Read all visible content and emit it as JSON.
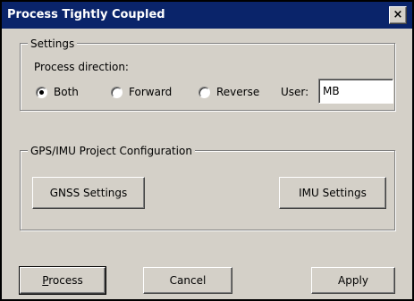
{
  "window": {
    "title": "Process Tightly Coupled",
    "close_label": "×"
  },
  "settings": {
    "legend": "Settings",
    "process_direction_label": "Process direction:",
    "options": [
      {
        "label": "Both",
        "selected": true
      },
      {
        "label": "Forward",
        "selected": false
      },
      {
        "label": "Reverse",
        "selected": false
      }
    ],
    "user_label": "User:",
    "user_value": "MB"
  },
  "gps_imu": {
    "legend": "GPS/IMU Project Configuration",
    "gnss_button": "GNSS Settings",
    "imu_button": "IMU Settings"
  },
  "footer": {
    "process_first": "P",
    "process_rest": "rocess",
    "cancel": "Cancel",
    "apply": "Apply"
  }
}
